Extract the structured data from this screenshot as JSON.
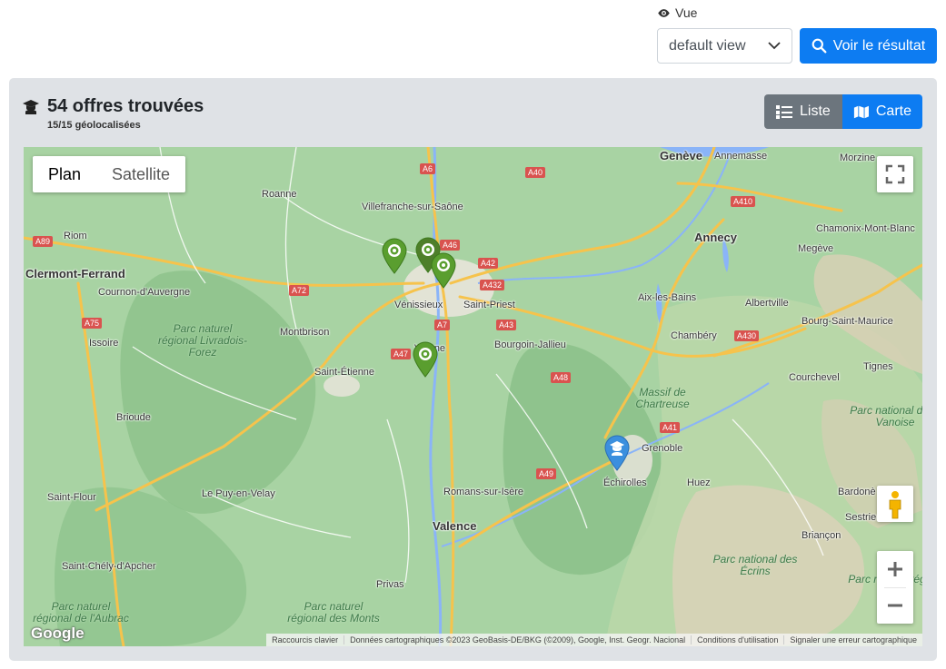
{
  "view": {
    "label": "Vue",
    "selected": "default view",
    "result_button": "Voir le résultat"
  },
  "card": {
    "title": "54 offres trouvées",
    "subtitle": "15/15 géolocalisées",
    "toggle_list": "Liste",
    "toggle_map": "Carte"
  },
  "map": {
    "type_plan": "Plan",
    "type_satellite": "Satellite",
    "google_logo": "Google",
    "attribution": {
      "shortcuts": "Raccourcis clavier",
      "data": "Données cartographiques ©2023 GeoBasis-DE/BKG (©2009), Google, Inst. Geogr. Nacional",
      "terms": "Conditions d'utilisation",
      "report": "Signaler une erreur cartographique"
    },
    "places": [
      {
        "name": "Genève",
        "major": true
      },
      {
        "name": "Annemasse",
        "major": false
      },
      {
        "name": "Morzine",
        "major": false
      },
      {
        "name": "Roanne",
        "major": false
      },
      {
        "name": "Villefranche-sur-Saône",
        "major": false
      },
      {
        "name": "Riom",
        "major": false
      },
      {
        "name": "Clermont-Ferrand",
        "major": true
      },
      {
        "name": "Cournon-d'Auvergne",
        "major": false
      },
      {
        "name": "Vénissieux",
        "major": false
      },
      {
        "name": "Saint-Priest",
        "major": false
      },
      {
        "name": "Annecy",
        "major": true
      },
      {
        "name": "Megève",
        "major": false
      },
      {
        "name": "Chamonix-Mont-Blanc",
        "major": false
      },
      {
        "name": "Aix-les-Bains",
        "major": false
      },
      {
        "name": "Albertville",
        "major": false
      },
      {
        "name": "Bourg-Saint-Maurice",
        "major": false
      },
      {
        "name": "Montbrison",
        "major": false
      },
      {
        "name": "Issoire",
        "major": false
      },
      {
        "name": "Vienne",
        "major": false
      },
      {
        "name": "Bourgoin-Jallieu",
        "major": false
      },
      {
        "name": "Chambéry",
        "major": false
      },
      {
        "name": "Saint-Étienne",
        "major": false
      },
      {
        "name": "Tignes",
        "major": false
      },
      {
        "name": "Courchevel",
        "major": false
      },
      {
        "name": "Brioude",
        "major": false
      },
      {
        "name": "Grenoble",
        "major": false
      },
      {
        "name": "Échirolles",
        "major": false
      },
      {
        "name": "Huez",
        "major": false
      },
      {
        "name": "Saint-Flour",
        "major": false
      },
      {
        "name": "Le Puy-en-Velay",
        "major": false
      },
      {
        "name": "Romans-sur-Isère",
        "major": false
      },
      {
        "name": "Valence",
        "major": true
      },
      {
        "name": "Bardonè",
        "major": false
      },
      {
        "name": "Sestriere",
        "major": false
      },
      {
        "name": "Briançon",
        "major": false
      },
      {
        "name": "Saint-Chély-d'Apcher",
        "major": false
      },
      {
        "name": "Privas",
        "major": false
      }
    ],
    "areas": [
      "Parc naturel régional Livradois-Forez",
      "Massif de Chartreuse",
      "Parc national de la Vanoise",
      "Parc national des Écrins",
      "Parc naturel régional de l'Aubrac",
      "Parc naturel régional des Monts",
      "Parc naturel rég... Quey"
    ],
    "roads": [
      "A6",
      "A40",
      "A89",
      "A46",
      "A42",
      "A72",
      "A432",
      "A75",
      "A43",
      "A7",
      "A47",
      "A48",
      "A41",
      "A430",
      "A49",
      "A410"
    ]
  },
  "colors": {
    "primary": "#0d7cf2",
    "secondary": "#6c757d",
    "card_bg": "#dfe2e6",
    "marker_green": "#5a9e2f",
    "marker_blue": "#3b8fde"
  },
  "icons": {
    "eye": "eye-icon",
    "search": "search-icon",
    "graduate": "graduate-icon",
    "list": "list-icon",
    "map": "map-icon",
    "fullscreen": "fullscreen-icon",
    "pegman": "pegman-icon",
    "zoom_in": "plus-icon",
    "zoom_out": "minus-icon"
  }
}
